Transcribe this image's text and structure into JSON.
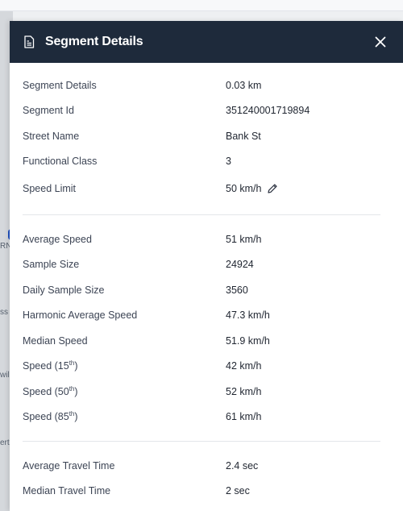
{
  "panel": {
    "title": "Segment Details",
    "header_icon": "document-icon",
    "close_icon": "close-icon"
  },
  "map_fragments": [
    "RN",
    "ss",
    "wil",
    "ert"
  ],
  "sections": [
    {
      "rows": [
        {
          "label": "Segment Details",
          "value": "0.03 km"
        },
        {
          "label": "Segment Id",
          "value": "351240001719894"
        },
        {
          "label": "Street Name",
          "value": "Bank St"
        },
        {
          "label": "Functional Class",
          "value": "3"
        },
        {
          "label": "Speed Limit",
          "value": "50 km/h",
          "editable": true
        }
      ]
    },
    {
      "rows": [
        {
          "label": "Average Speed",
          "value": "51 km/h"
        },
        {
          "label": "Sample Size",
          "value": "24924"
        },
        {
          "label": "Daily Sample Size",
          "value": "3560"
        },
        {
          "label": "Harmonic Average Speed",
          "value": "47.3 km/h"
        },
        {
          "label": "Median Speed",
          "value": "51.9 km/h"
        },
        {
          "label_prefix": "Speed (15",
          "label_sup": "th",
          "label_suffix": ")",
          "value": "42 km/h"
        },
        {
          "label_prefix": "Speed (50",
          "label_sup": "th",
          "label_suffix": ")",
          "value": "52 km/h"
        },
        {
          "label_prefix": "Speed (85",
          "label_sup": "th",
          "label_suffix": ")",
          "value": "61 km/h"
        }
      ]
    },
    {
      "rows": [
        {
          "label": "Average Travel Time",
          "value": "2.4 sec"
        },
        {
          "label": "Median Travel Time",
          "value": "2 sec"
        }
      ]
    }
  ],
  "colors": {
    "header_bg": "#1e2a3b",
    "header_text": "#ffffff",
    "divider": "#e3e6ea"
  }
}
